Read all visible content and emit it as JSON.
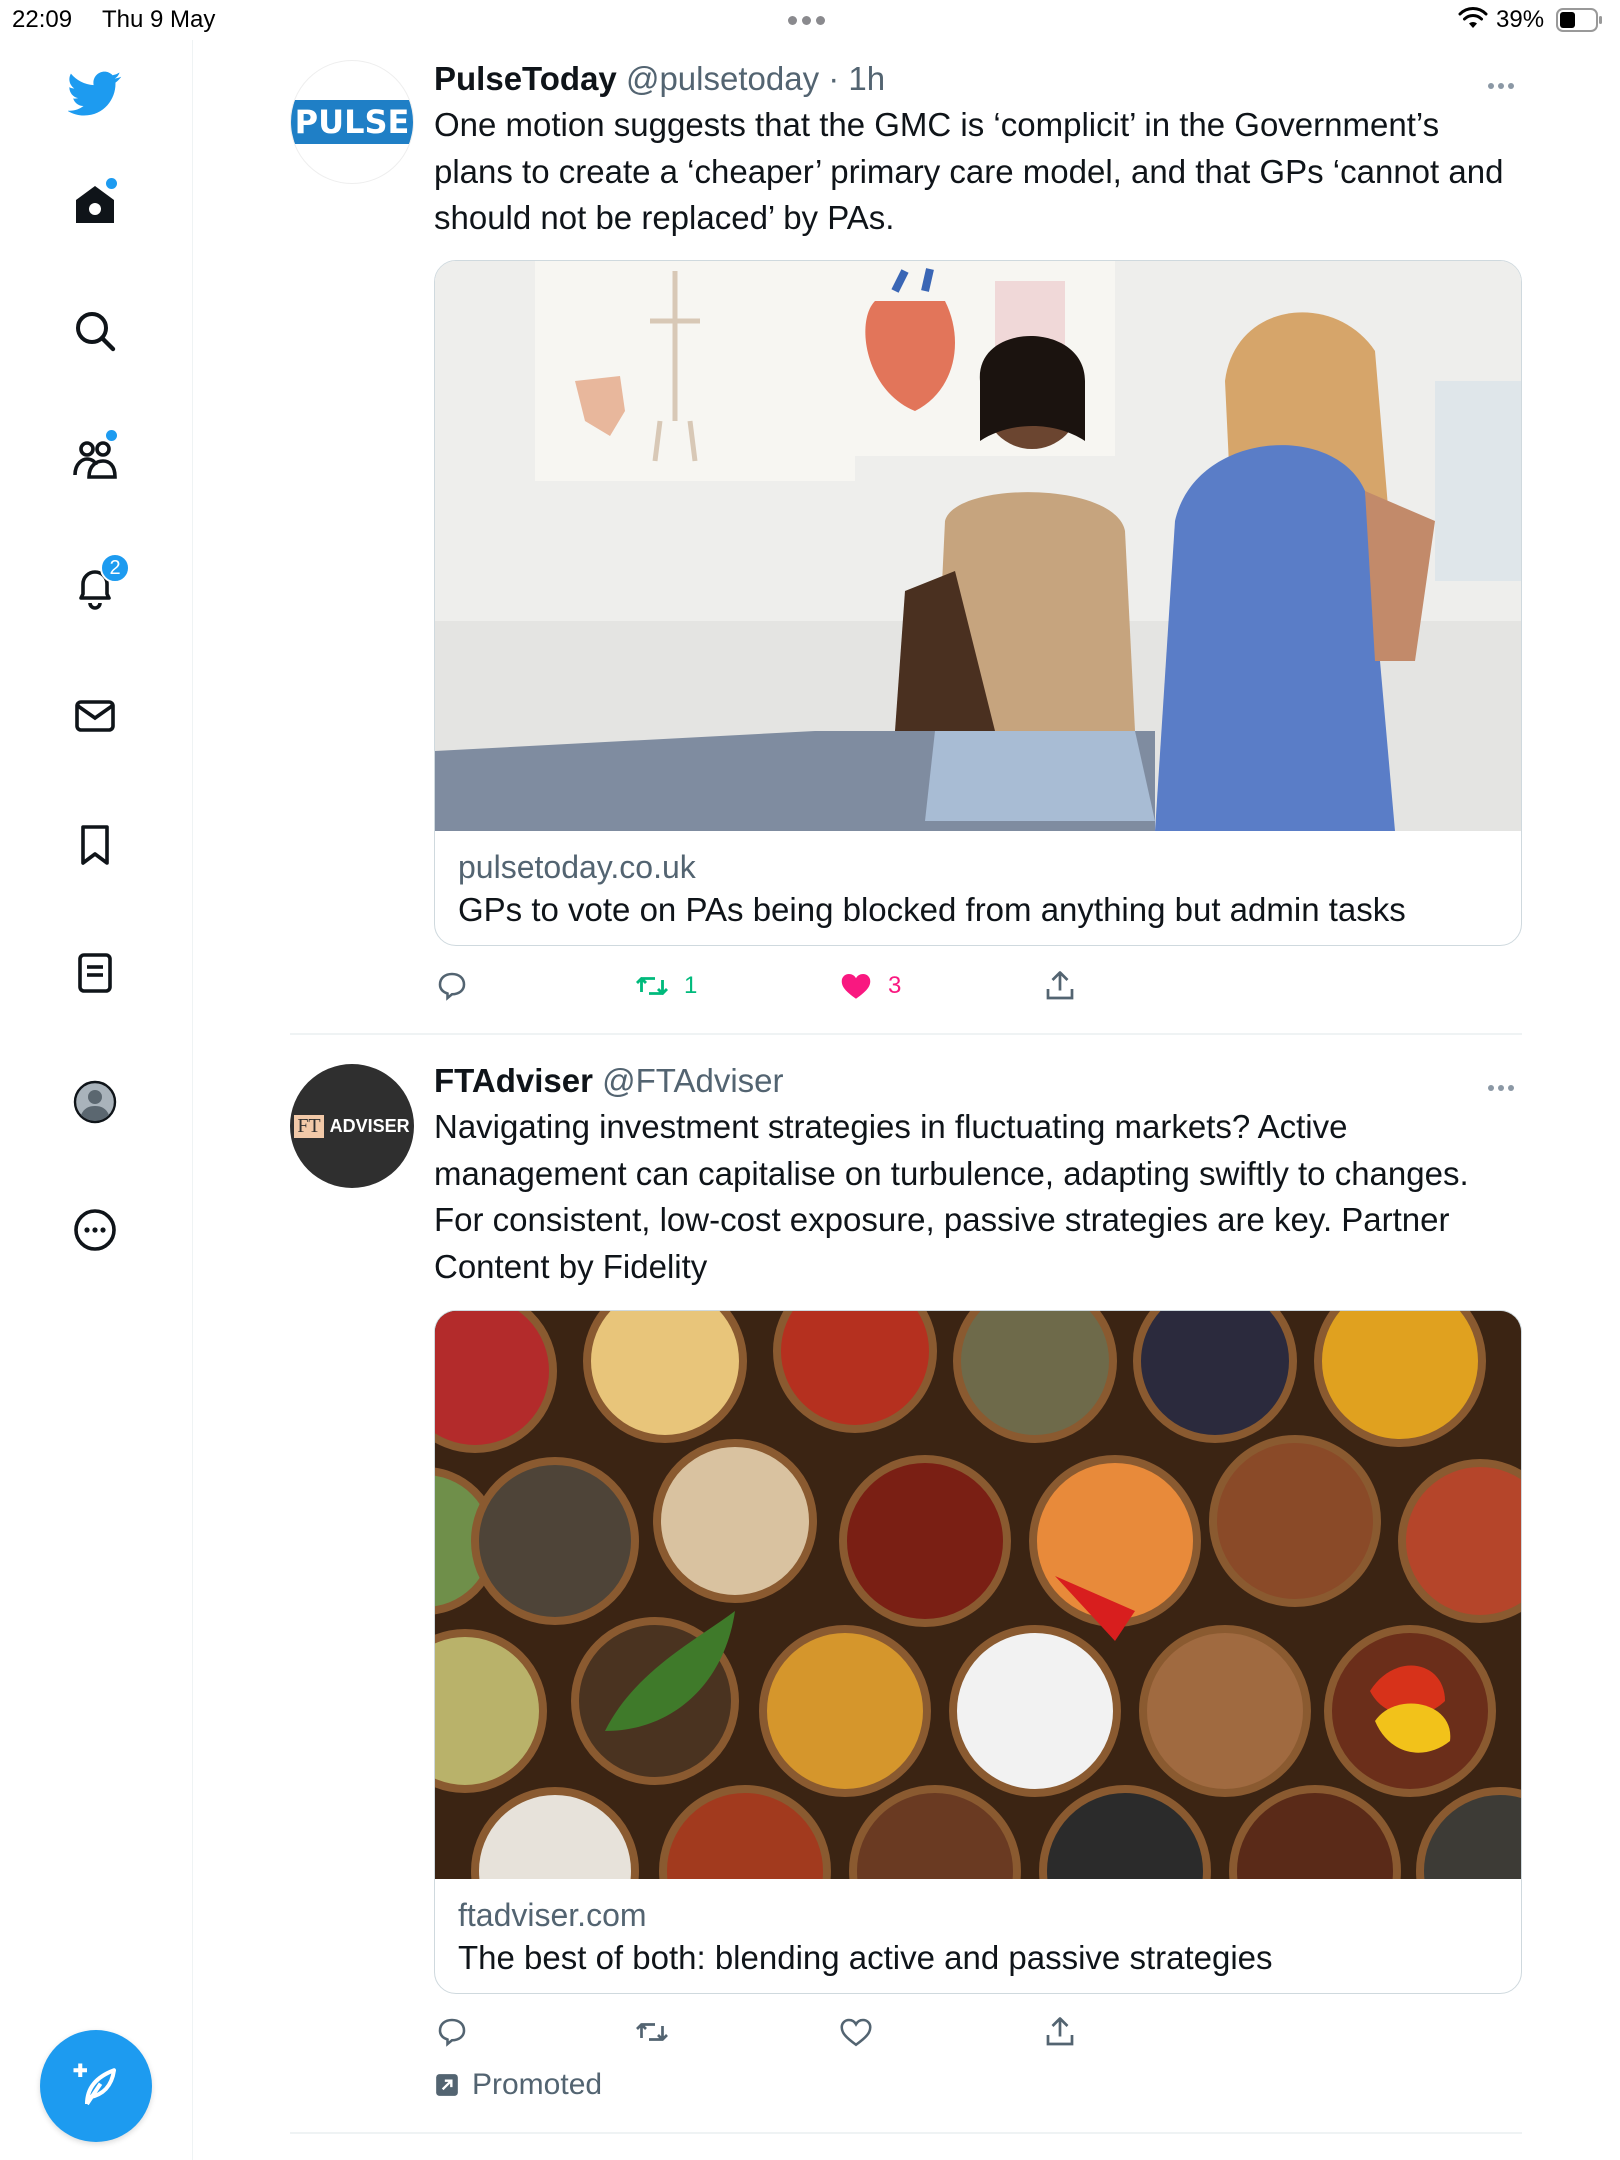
{
  "status_bar": {
    "time": "22:09",
    "date": "Thu 9 May",
    "battery": "39%"
  },
  "sidebar": {
    "items": [
      {
        "name": "twitter-logo-icon"
      },
      {
        "name": "home-icon"
      },
      {
        "name": "search-icon"
      },
      {
        "name": "communities-icon"
      },
      {
        "name": "notifications-icon",
        "badge": "2"
      },
      {
        "name": "messages-icon"
      },
      {
        "name": "bookmarks-icon"
      },
      {
        "name": "lists-icon"
      },
      {
        "name": "profile-icon"
      },
      {
        "name": "more-icon"
      }
    ],
    "compose_icon": "compose-tweet-icon"
  },
  "colors": {
    "brand": "#1d9bf0",
    "like_active": "#f91880",
    "retweet_active": "#00ba7c",
    "secondary_text": "#536471"
  },
  "tweets": [
    {
      "display_name": "PulseToday",
      "handle": "@pulsetoday",
      "time": "· 1h",
      "avatar_text": "PULSE",
      "text": "One motion suggests that the GMC is ‘complicit’ in the Government’s plans to create a ‘cheaper’ primary care model, and that GPs ‘cannot and should not be replaced’ by PAs.",
      "card": {
        "domain": "pulsetoday.co.uk",
        "title": "GPs to vote on PAs being blocked from anything but admin tasks"
      },
      "actions": {
        "retweets": "1",
        "likes": "3"
      }
    },
    {
      "display_name": "FTAdviser",
      "handle": "@FTAdviser",
      "avatar_text_ft": "FT",
      "avatar_text": "ADVISER",
      "text": "Navigating investment strategies in fluctuating markets? Active management can capitalise on turbulence, adapting swiftly to changes. For consistent, low-cost exposure, passive strategies are key. Partner Content by Fidelity",
      "card": {
        "domain": "ftadviser.com",
        "title": "The best of both: blending active and passive strategies"
      },
      "promoted_label": "Promoted"
    }
  ]
}
